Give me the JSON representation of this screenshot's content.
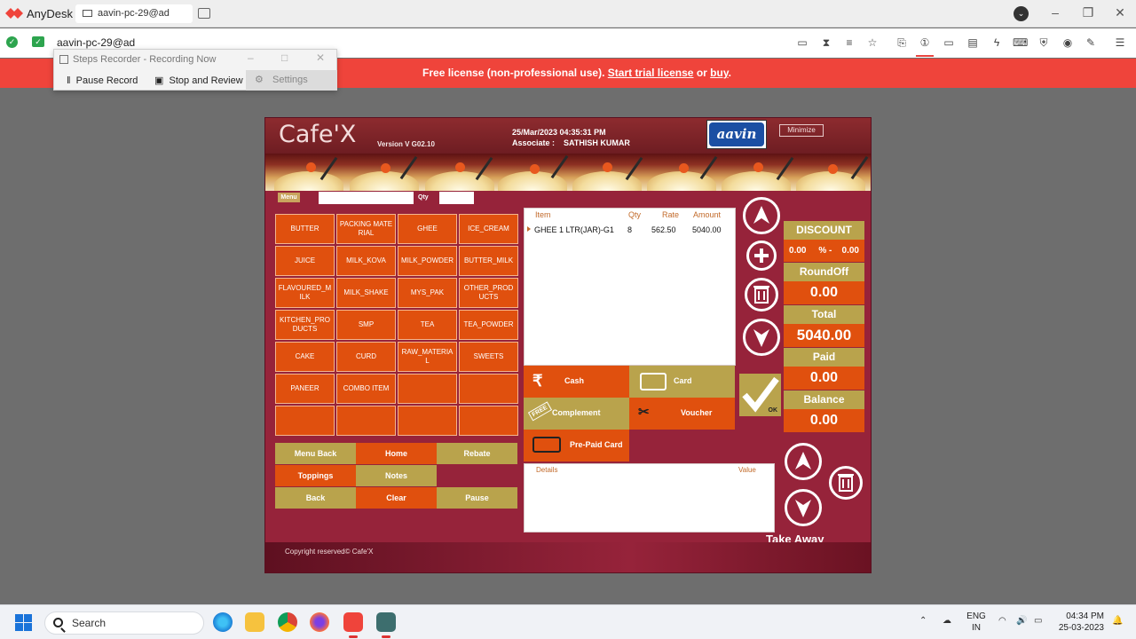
{
  "anydesk": {
    "app_name": "AnyDesk",
    "tab_label": "aavin-pc-29@ad",
    "address": "aavin-pc-29@ad"
  },
  "license_bar": {
    "prefix": "Free license (non-professional use).",
    "trial_link": "Start trial license",
    "or": "or",
    "buy_link": "buy",
    "suffix": "."
  },
  "steps_recorder": {
    "title": "Steps Recorder - Recording Now",
    "pause_label": "Pause Record",
    "stop_label": "Stop and Review",
    "settings_label": "Settings"
  },
  "app": {
    "logo": "Cafe'X",
    "version": "Version V G02.10",
    "datetime": "25/Mar/2023 04:35:31 PM",
    "associate_label": "Associate :",
    "associate_name": "SATHISH KUMAR",
    "brand_logo": "aavin",
    "minimize_label": "Minimize",
    "menu_label": "Menu",
    "qty_label": "Qty",
    "categories": [
      "BUTTER",
      "PACKING MATERIAL",
      "GHEE",
      "ICE_CREAM",
      "JUICE",
      "MILK_KOVA",
      "MILK_POWDER",
      "BUTTER_MILK",
      "FLAVOURED_MILK",
      "MILK_SHAKE",
      "MYS_PAK",
      "OTHER_PRODUCTS",
      "KITCHEN_PRODUCTS",
      "SMP",
      "TEA",
      "TEA_POWDER",
      "CAKE",
      "CURD",
      "RAW_MATERIAL",
      "SWEETS",
      "PANEER",
      "COMBO ITEM",
      "",
      "",
      "",
      "",
      "",
      ""
    ],
    "controls": {
      "menu_back": "Menu Back",
      "home": "Home",
      "rebate": "Rebate",
      "toppings": "Toppings",
      "notes": "Notes",
      "back": "Back",
      "clear": "Clear",
      "pause": "Pause"
    },
    "item_table": {
      "headers": {
        "item": "Item",
        "qty": "Qty",
        "rate": "Rate",
        "amount": "Amount"
      },
      "rows": [
        {
          "item": "GHEE 1 LTR(JAR)-G1",
          "qty": "8",
          "rate": "562.50",
          "amount": "5040.00"
        }
      ]
    },
    "payments": {
      "cash": "Cash",
      "card": "Card",
      "complement": "Complement",
      "voucher": "Voucher",
      "prepaid": "Pre-Paid Card",
      "free_tag": "FREE"
    },
    "details": {
      "details_header": "Details",
      "value_header": "Value"
    },
    "ok_label": "OK",
    "summary": {
      "discount_label": "DISCOUNT",
      "discount_pct": "0.00",
      "discount_sep": "% -",
      "discount_amt": "0.00",
      "roundoff_label": "RoundOff",
      "roundoff": "0.00",
      "total_label": "Total",
      "total": "5040.00",
      "paid_label": "Paid",
      "paid": "0.00",
      "balance_label": "Balance",
      "balance": "0.00"
    },
    "take_away": "Take Away",
    "copyright": "Copyright reserved©  Cafe'X"
  },
  "taskbar": {
    "search_placeholder": "Search",
    "lang_line1": "ENG",
    "lang_line2": "IN",
    "time": "04:34 PM",
    "date": "25-03-2023"
  },
  "colors": {
    "app_background": "#96233a",
    "orange_button": "#e0500e",
    "olive_button": "#b9a34c",
    "license_bar": "#ef443b"
  }
}
